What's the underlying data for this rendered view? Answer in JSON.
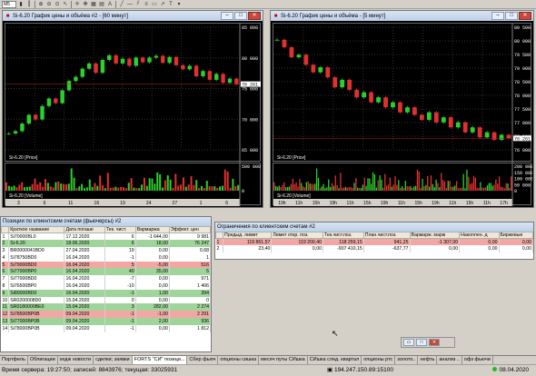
{
  "toolbar": {
    "combo": "M5"
  },
  "chart1": {
    "title": "Si-6.20 График цены и объёма #2 - [60 минут]",
    "price_label": "Si-6.20 [Price]",
    "volume_label": "Si-6.20 [Volume]",
    "y_ticks": [
      "85 000",
      "80 000",
      "75 000",
      "70 000",
      "65 000"
    ],
    "current_price": "76 261",
    "vol_ticks": [
      "500 000",
      "0"
    ],
    "x_ticks": [
      "3",
      "6",
      "11",
      "16",
      "19",
      "24",
      "27",
      "1",
      "6"
    ],
    "x_months": [
      "Мар",
      "Апр"
    ],
    "chart_data": {
      "type": "line",
      "series": [
        {
          "name": "Si-6.20",
          "values": [
            67800,
            68200,
            69500,
            71000,
            70200,
            72500,
            73800,
            73000,
            75200,
            76800,
            77500,
            78900,
            79800,
            78200,
            80400,
            81200,
            79800,
            80600,
            79400,
            80800,
            80000,
            80800,
            81100,
            79900,
            80900,
            79500,
            78800,
            79400,
            77600,
            78500,
            77000,
            78000,
            76500,
            77200,
            76261
          ]
        }
      ],
      "ylim": [
        65000,
        86000
      ]
    }
  },
  "chart2": {
    "title": "Si-6.20 График цены и объёма - [5 минут]",
    "price_label": "Si-6.20 [Price]",
    "volume_label": "Si-6.20 [Volume]",
    "y_ticks": [
      "80 500",
      "80 000",
      "79 500",
      "79 000",
      "78 500",
      "78 000",
      "77 500",
      "77 000",
      "76 500",
      "76 000"
    ],
    "current_price": "76 261",
    "vol_ticks": [
      "200 000",
      "150 000",
      "100 000",
      "50 000",
      "0"
    ],
    "x_ticks": [
      "19h",
      "11h",
      "15h",
      "19h",
      "11h",
      "15h",
      "19h",
      "11h",
      "15h",
      "19h",
      "11h",
      "15h",
      "11h",
      "17h"
    ],
    "x_days": [
      "3",
      "6",
      "7",
      "8"
    ],
    "chart_data": {
      "type": "line",
      "series": [
        {
          "name": "Si-6.20",
          "values": [
            80200,
            79900,
            79500,
            79600,
            79200,
            78900,
            79100,
            78700,
            78300,
            78600,
            78200,
            77900,
            78100,
            77700,
            77900,
            77500,
            77700,
            77300,
            77500,
            77200,
            77000,
            77300,
            76900,
            77100,
            76700,
            76900,
            76500,
            76700,
            76300,
            76500,
            76200,
            76400,
            76261
          ]
        }
      ],
      "ylim": [
        75800,
        80700
      ]
    }
  },
  "positions": {
    "title": "Позиции по клиентским счетам (фьючерсы) #2",
    "headers": [
      "Краткое название",
      "Дата погаше",
      "Тек. чист.",
      "Вармаржа",
      "Эффект. цен"
    ],
    "rows": [
      {
        "cls": "w",
        "n": "1",
        "name": "Si70000BL0",
        "date": "17.12.2020",
        "pos": "6",
        "var": "-1 644,00",
        "eff": "9 981"
      },
      {
        "cls": "g",
        "n": "2",
        "name": "Si-6.20",
        "date": "18.06.2020",
        "pos": "6",
        "var": "18,00",
        "eff": "76 247"
      },
      {
        "cls": "w",
        "n": "3",
        "name": "BR0000041BD0",
        "date": "27.04.2020",
        "pos": "19",
        "var": "0,00",
        "eff": "0,68"
      },
      {
        "cls": "w",
        "n": "4",
        "name": "Si78750BD0",
        "date": "16.04.2020",
        "pos": "-1",
        "var": "0,00",
        "eff": "1"
      },
      {
        "cls": "r",
        "n": "5",
        "name": "Si79000BD0",
        "date": "16.04.2020",
        "pos": "5",
        "var": "-5,00",
        "eff": "516"
      },
      {
        "cls": "g",
        "n": "6",
        "name": "Si77000BP0",
        "date": "16.04.2020",
        "pos": "40",
        "var": "35,00",
        "eff": "5"
      },
      {
        "cls": "w",
        "n": "7",
        "name": "Si77000BD0",
        "date": "16.04.2020",
        "pos": "-7",
        "var": "0,00",
        "eff": "971"
      },
      {
        "cls": "w",
        "n": "8",
        "name": "Si76500BP0",
        "date": "16.04.2020",
        "pos": "-10",
        "var": "0,00",
        "eff": "1 406"
      },
      {
        "cls": "g",
        "n": "9",
        "name": "Si80000BD0",
        "date": "16.04.2020",
        "pos": "-1",
        "var": "1,00",
        "eff": "394"
      },
      {
        "cls": "w",
        "n": "10",
        "name": "SR0200008D0",
        "date": "15.04.2020",
        "pos": "0",
        "var": "0,00",
        "eff": "0"
      },
      {
        "cls": "g",
        "n": "11",
        "name": "SR0180000BE0",
        "date": "15.04.2020",
        "pos": "3",
        "var": "282,00",
        "eff": "2 274"
      },
      {
        "cls": "r",
        "n": "12",
        "name": "Si78500BP0B",
        "date": "09.04.2020",
        "pos": "-1",
        "var": "-1,00",
        "eff": "2 291"
      },
      {
        "cls": "g",
        "n": "13",
        "name": "Si77000BP0B",
        "date": "09.04.2020",
        "pos": "-1",
        "var": "2,00",
        "eff": "936"
      },
      {
        "cls": "w",
        "n": "14",
        "name": "Si78000BP0B",
        "date": "09.04.2020",
        "pos": "-1",
        "var": "0,00",
        "eff": "1 812"
      }
    ]
  },
  "limits": {
    "title": "Ограничения по клиентским счетам #2",
    "headers": [
      "Предыд. лимит",
      "Лимит откр. поз.",
      "Тек.чист.поз.",
      "План.чист.поз.",
      "Вармарж. марж",
      "Накоплен. д",
      "Биржевые"
    ],
    "rows": [
      {
        "cls": "r",
        "n": "1",
        "c": [
          "119 861,57",
          "119 200,40",
          "118 259,15",
          "941,25",
          "-1 307,00",
          "0,00",
          "0,00"
        ]
      },
      {
        "cls": "w",
        "n": "2",
        "c": [
          "23,40",
          "0,00",
          "-907 410,15",
          "-637,77",
          "0,00",
          "0,00",
          "0,00"
        ]
      }
    ]
  },
  "tabs": [
    "Портфель",
    "Облигации",
    "хедж новости",
    "сделки; заявки",
    "FORTS \"СИ\" позици...",
    "Сбер фьюч",
    "опционы сишка",
    "месяч путы СИшка",
    "СИшка след. квартал",
    "опционы ртс",
    "золото..",
    "нефть",
    "анализ ..",
    "офз фьючи"
  ],
  "status": {
    "server_time": "Время сервера: 19:27:50; записей: 8843976; текущая: 33025931",
    "ip": "194.247.150.89:15100",
    "date": "08.04.2020"
  }
}
